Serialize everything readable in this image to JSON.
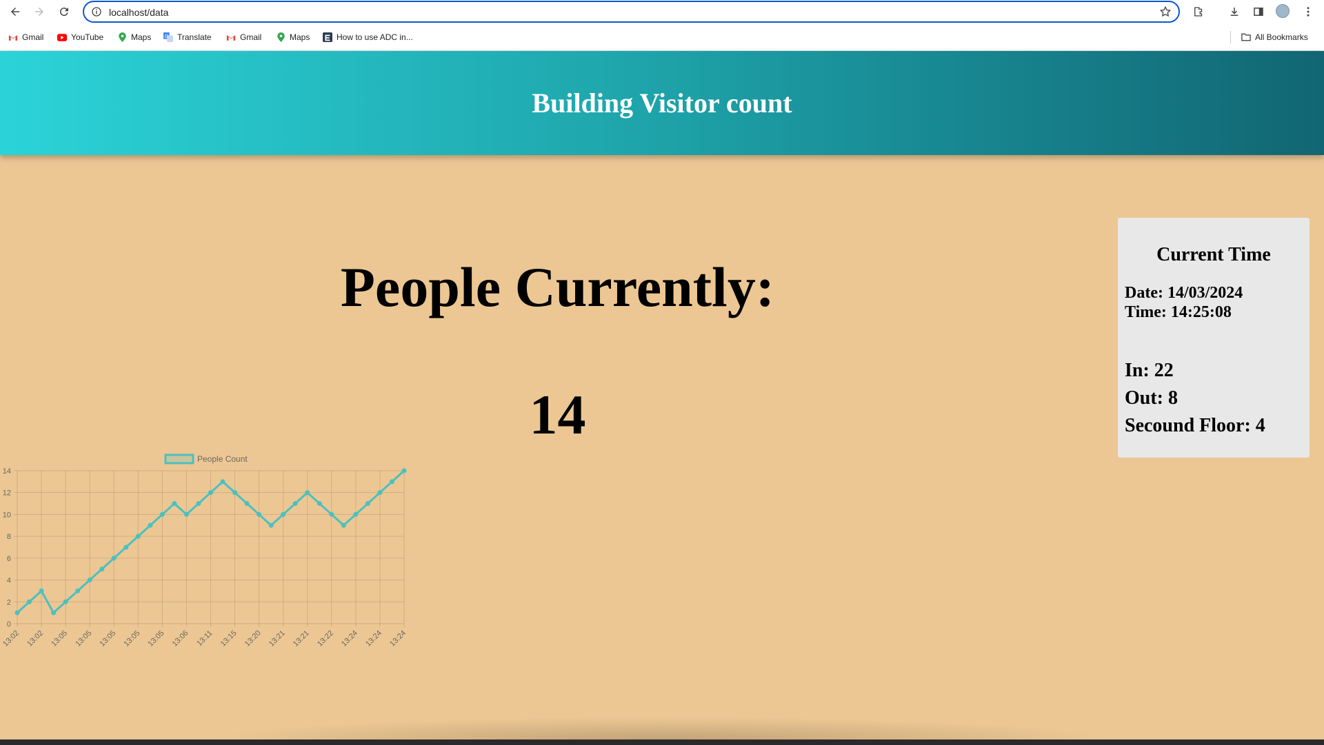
{
  "browser": {
    "url": "localhost/data",
    "bookmarks": [
      {
        "label": "Gmail",
        "icon": "gmail-icon"
      },
      {
        "label": "YouTube",
        "icon": "youtube-icon"
      },
      {
        "label": "Maps",
        "icon": "maps-icon"
      },
      {
        "label": "Translate",
        "icon": "translate-icon"
      },
      {
        "label": "Gmail",
        "icon": "gmail-icon"
      },
      {
        "label": "Maps",
        "icon": "maps-icon"
      },
      {
        "label": "How to use ADC in...",
        "icon": "bookmark-site-icon"
      }
    ],
    "all_bookmarks": "All Bookmarks"
  },
  "page": {
    "title": "Building Visitor count",
    "people_label": "People Currently:",
    "people_count": "14"
  },
  "time_card": {
    "heading": "Current Time",
    "date": "Date: 14/03/2024",
    "time": "Time: 14:25:08",
    "in": "In: 22",
    "out": "Out: 8",
    "second_floor": "Secound Floor: 4"
  },
  "colors": {
    "page_bg": "#ecc793",
    "header_start": "#2bd3d8",
    "header_end": "#116673",
    "series": "#4bc0c0"
  },
  "chart_data": {
    "type": "line",
    "legend": [
      "People Count"
    ],
    "x": [
      "13:02",
      "13:02",
      "13:02",
      "13:05",
      "13:05",
      "13:05",
      "13:05",
      "13:05",
      "13:05",
      "13:05",
      "13:05",
      "13:05",
      "13:05",
      "13:05",
      "13:06",
      "13:06",
      "13:11",
      "13:11",
      "13:15",
      "13:15",
      "13:20",
      "13:20",
      "13:21",
      "13:21",
      "13:21",
      "13:21",
      "13:22",
      "13:22",
      "13:24",
      "13:24",
      "13:24",
      "13:24",
      "13:24",
      "13:24"
    ],
    "x_tick_labels": [
      "13:02",
      "13:02",
      "13:05",
      "13:05",
      "13:05",
      "13:05",
      "13:05",
      "13:06",
      "13:11",
      "13:15",
      "13:20",
      "13:21",
      "13:21",
      "13:22",
      "13:24",
      "13:24",
      "13:24"
    ],
    "series": [
      {
        "name": "People Count",
        "values": [
          1,
          2,
          3,
          1,
          2,
          3,
          4,
          5,
          6,
          7,
          8,
          9,
          10,
          11,
          10,
          11,
          12,
          13,
          12,
          11,
          10,
          9,
          10,
          11,
          12,
          11,
          10,
          9,
          10,
          11,
          12,
          13,
          14
        ]
      }
    ],
    "ylim": [
      0,
      14
    ],
    "y_ticks": [
      0,
      2,
      4,
      6,
      8,
      10,
      12,
      14
    ],
    "grid": true,
    "legend_position": "top"
  }
}
